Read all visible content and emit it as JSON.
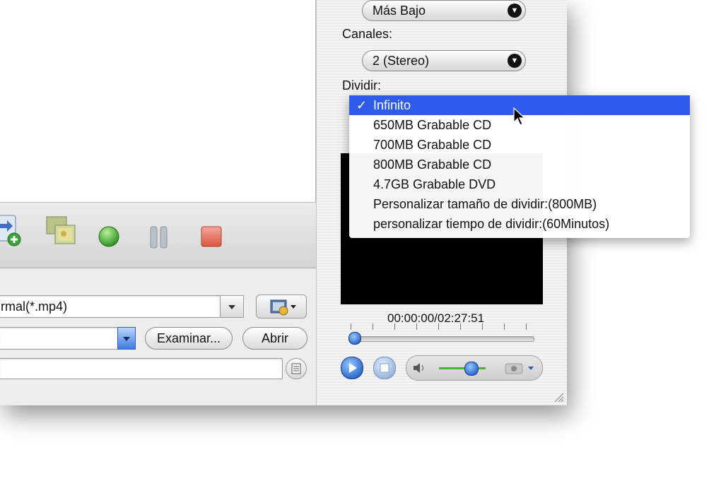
{
  "audio": {
    "quality_value": "Más Bajo"
  },
  "channels": {
    "label": "Canales:",
    "value": "2 (Stereo)"
  },
  "split": {
    "label": "Dividir:",
    "options": [
      "Infinito",
      "650MB Grabable CD",
      "700MB Grabable CD",
      "800MB Grabable CD",
      "4.7GB Grabable DVD",
      "Personalizar tamaño de dividir:(800MB)",
      "personalizar tiempo de dividir:(60Minutos)"
    ],
    "selected_index": 0,
    "check_mark": "✓"
  },
  "player": {
    "timecode": "00:00:00/02:27:51"
  },
  "output": {
    "format_value": "rmal(*.mp4)",
    "path_value": "",
    "browse_label": "Examinar...",
    "open_label": "Abrir",
    "log_value": ""
  },
  "colors": {
    "selection": "#2f5bea",
    "record_green": "#3fae2f",
    "stop_red": "#e0695a",
    "play_blue": "#2f6fd0"
  }
}
